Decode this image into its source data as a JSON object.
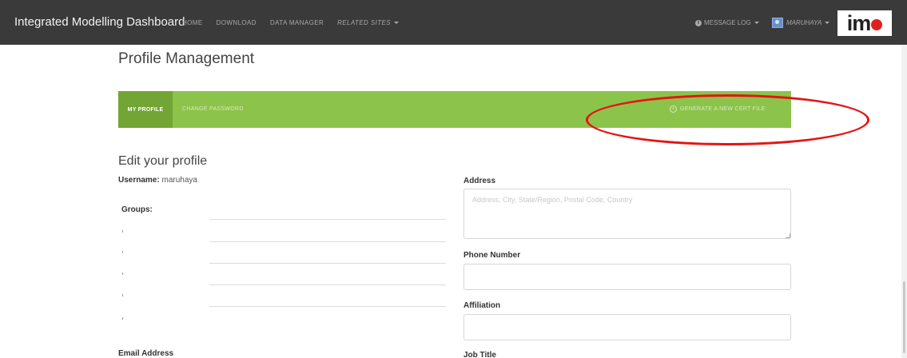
{
  "navbar": {
    "brand": "Integrated Modelling Dashboard",
    "links": [
      {
        "label": "HOME"
      },
      {
        "label": "DOWNLOAD"
      },
      {
        "label": "DATA MANAGER"
      },
      {
        "label": "RELATED SITES"
      }
    ],
    "message_log": "MESSAGE LOG",
    "user": "MARUHAYA",
    "logo_text": "im"
  },
  "page": {
    "title": "Profile Management"
  },
  "tabs": {
    "my_profile": "MY PROFILE",
    "change_password": "CHANGE PASSWORD",
    "generate_cert": "GENERATE A NEW CERT FILE"
  },
  "form": {
    "section_title": "Edit your profile",
    "username_label": "Username:",
    "username_value": "maruhaya",
    "groups_label": "Groups:",
    "email_label": "Email Address",
    "address_label": "Address",
    "address_placeholder": "Address, City, State/Region, Postal Code, Country",
    "address_value": "",
    "phone_label": "Phone Number",
    "phone_value": "",
    "affiliation_label": "Affiliation",
    "affiliation_value": "",
    "job_title_label": "Job Title"
  },
  "colors": {
    "navbar": "#3a3a3a",
    "tab_bar": "#8cc34a",
    "tab_active": "#72a534",
    "highlight": "#e61414"
  },
  "icons": {
    "message_log": "info-circle-icon",
    "cert": "plus-circle-icon",
    "user": "user-avatar-icon"
  }
}
